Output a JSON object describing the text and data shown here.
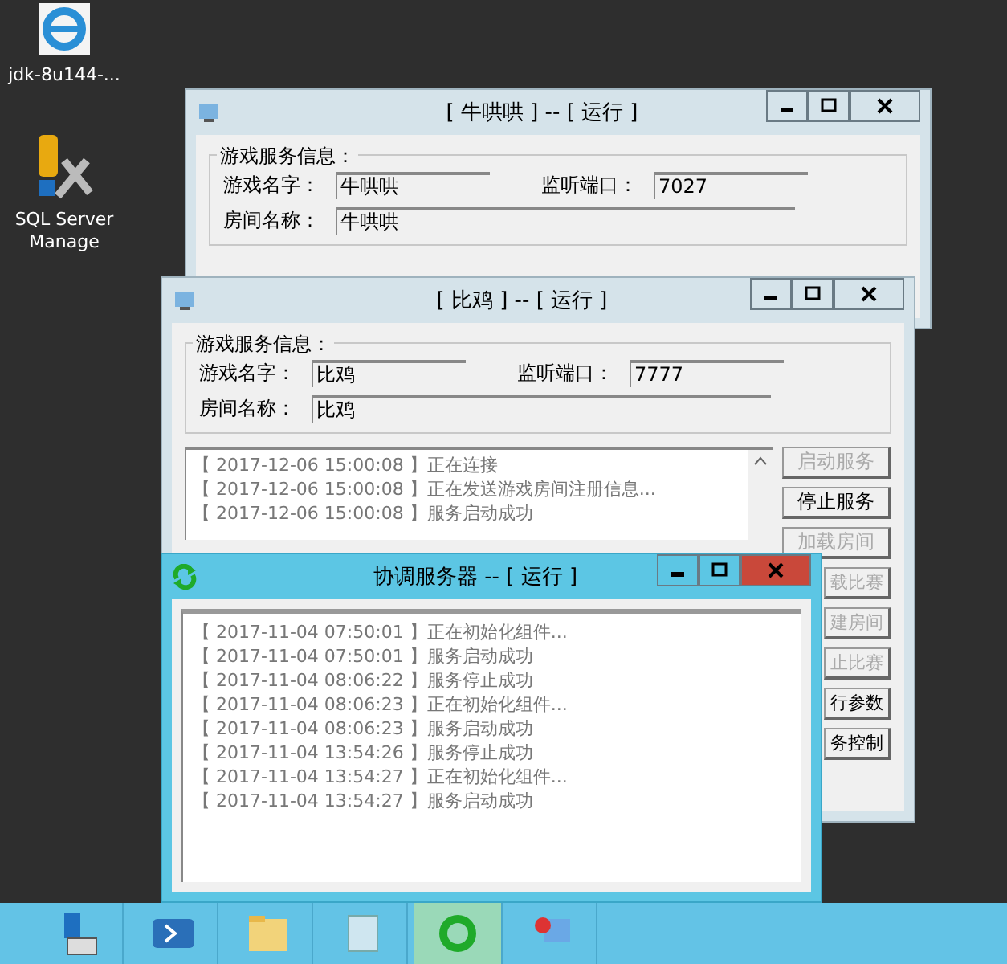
{
  "desktop_icons": [
    {
      "label": "jdk-8u144-..."
    },
    {
      "label": "SQL Server Manage"
    }
  ],
  "windows": [
    {
      "title": "[ 牛哄哄 ] -- [ 运行 ]",
      "active": false,
      "info": {
        "group_title": "游戏服务信息：",
        "game_name_label": "游戏名字：",
        "game_name": "牛哄哄",
        "port_label": "监听端口：",
        "port": "7027",
        "room_name_label": "房间名称：",
        "room_name": "牛哄哄"
      }
    },
    {
      "title": "[ 比鸡 ] -- [ 运行 ]",
      "active": false,
      "info": {
        "group_title": "游戏服务信息：",
        "game_name_label": "游戏名字：",
        "game_name": "比鸡",
        "port_label": "监听端口：",
        "port": "7777",
        "room_name_label": "房间名称：",
        "room_name": "比鸡"
      },
      "log": [
        "【 2017-12-06 15:00:08 】正在连接",
        "【 2017-12-06 15:00:08 】正在发送游戏房间注册信息...",
        "【 2017-12-06 15:00:08 】服务启动成功"
      ],
      "buttons": [
        {
          "label": "启动服务",
          "disabled": true,
          "partial": false
        },
        {
          "label": "停止服务",
          "disabled": false,
          "partial": false
        },
        {
          "label": "加载房间",
          "disabled": true,
          "partial": false
        },
        {
          "label": "载比赛",
          "disabled": true,
          "partial": true
        },
        {
          "label": "建房间",
          "disabled": true,
          "partial": true
        },
        {
          "label": "止比赛",
          "disabled": true,
          "partial": true
        },
        {
          "label": "行参数",
          "disabled": false,
          "partial": true
        },
        {
          "label": "务控制",
          "disabled": false,
          "partial": true
        }
      ]
    },
    {
      "title": "协调服务器 -- [ 运行 ]",
      "active": true,
      "log": [
        "【 2017-11-04 07:50:01 】正在初始化组件...",
        "【 2017-11-04 07:50:01 】服务启动成功",
        "【 2017-11-04 08:06:22 】服务停止成功",
        "【 2017-11-04 08:06:23 】正在初始化组件...",
        "【 2017-11-04 08:06:23 】服务启动成功",
        "【 2017-11-04 13:54:26 】服务停止成功",
        "【 2017-11-04 13:54:27 】正在初始化组件...",
        "【 2017-11-04 13:54:27 】服务启动成功"
      ]
    }
  ],
  "taskbar": [
    {
      "selected": false
    },
    {
      "selected": false
    },
    {
      "selected": false
    },
    {
      "selected": false
    },
    {
      "selected": true
    },
    {
      "selected": false
    }
  ]
}
